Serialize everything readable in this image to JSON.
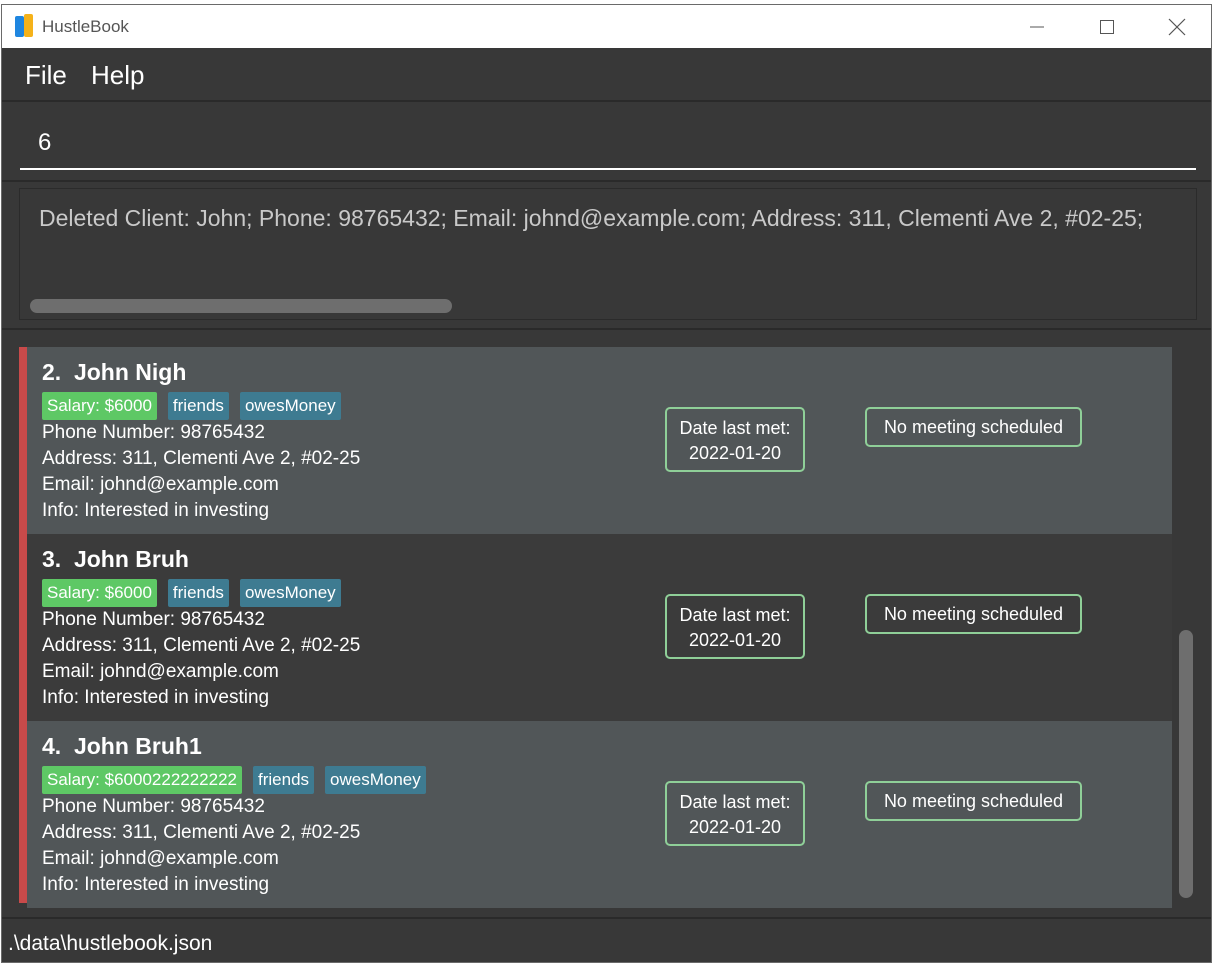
{
  "window": {
    "title": "HustleBook",
    "app_icon": "hustlebook-book-icon"
  },
  "menu": {
    "file": "File",
    "help": "Help"
  },
  "command": {
    "value": "6"
  },
  "result": {
    "text": "Deleted Client: John; Phone: 98765432; Email: johnd@example.com; Address: 311, Clementi Ave 2, #02-25;"
  },
  "persons": [
    {
      "index": "2.",
      "name": "John Nigh",
      "tags": [
        "Salary: $6000",
        "friends",
        "owesMoney"
      ],
      "phone": "Phone Number: 98765432",
      "address": "Address: 311, Clementi Ave 2, #02-25",
      "email": "Email: johnd@example.com",
      "info": "Info: Interested in investing",
      "date_label": "Date last met:",
      "date_value": "2022-01-20",
      "meeting": "No meeting scheduled"
    },
    {
      "index": "3.",
      "name": "John Bruh",
      "tags": [
        "Salary: $6000",
        "friends",
        "owesMoney"
      ],
      "phone": "Phone Number: 98765432",
      "address": "Address: 311, Clementi Ave 2, #02-25",
      "email": "Email: johnd@example.com",
      "info": "Info: Interested in investing",
      "date_label": "Date last met:",
      "date_value": "2022-01-20",
      "meeting": "No meeting scheduled"
    },
    {
      "index": "4.",
      "name": "John Bruh1",
      "tags": [
        "Salary: $6000222222222",
        "friends",
        "owesMoney"
      ],
      "phone": "Phone Number: 98765432",
      "address": "Address: 311, Clementi Ave 2, #02-25",
      "email": "Email: johnd@example.com",
      "info": "Info: Interested in investing",
      "date_label": "Date last met:",
      "date_value": "2022-01-20",
      "meeting": "No meeting scheduled"
    }
  ],
  "status": {
    "path": ".\\data\\hustlebook.json"
  },
  "colors": {
    "background": "#383838",
    "card_odd": "#515658",
    "card_even": "#3b3b3b",
    "accent": "#c84a4a",
    "salary_tag": "#5ec865",
    "tag": "#3e7b91",
    "badge_border": "#8fcf98"
  }
}
